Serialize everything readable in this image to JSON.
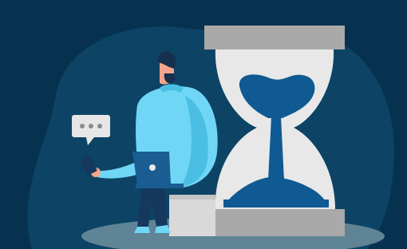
{
  "illustration": {
    "subject": "person-with-laptop-beside-hourglass",
    "colors": {
      "background": "#07324f",
      "blob": "#0d4465",
      "floor_shadow": "#5f8496",
      "sweater": "#6fd7f5",
      "sweater_shade": "#4bbfe3",
      "skin": "#f2a48c",
      "hair": "#16314d",
      "pants": "#16385f",
      "laptop": "#1a5d93",
      "hourglass_frame": "#a9a9a9",
      "hourglass_glass": "#e8e8e8",
      "sand": "#0f5a92",
      "seat": "#d9d9d9",
      "bubble": "#e6e6e6"
    },
    "icons": [
      "chat-bubble-icon",
      "phone-icon",
      "laptop-icon",
      "hourglass-icon"
    ]
  }
}
